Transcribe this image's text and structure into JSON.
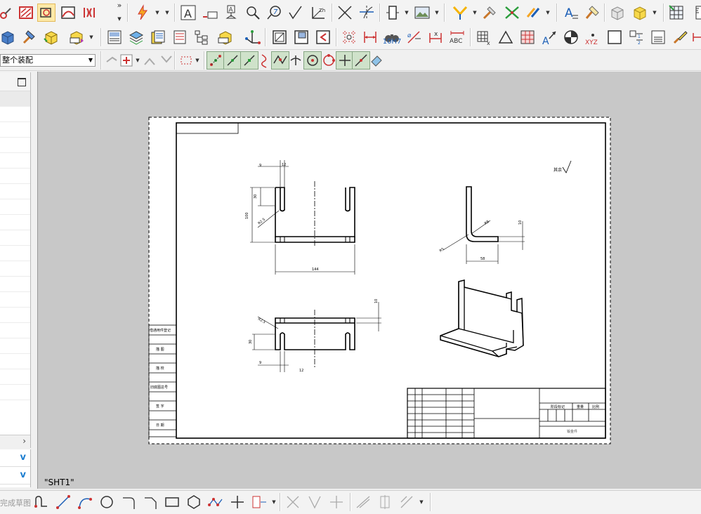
{
  "toolbar": {
    "overflow_label": "»",
    "assembly_filter": "整个装配",
    "text_icon_label": "A",
    "fit_label": "10H7",
    "abc_label": "ABC",
    "xyz_label": "XYZ"
  },
  "sidebar": {
    "rows": 20,
    "scroll_arrow": "›",
    "chevron_1": "v",
    "chevron_2": "v"
  },
  "drawing": {
    "sheet_name": "\"SHT1\"",
    "front_view": {
      "dim_top_left": "9",
      "dim_top_right": "12",
      "dim_slot": "30",
      "dim_height": "100",
      "dim_radius": "R2.5",
      "dim_width": "144"
    },
    "side_view": {
      "dim_radius_big": "R5",
      "dim_radius_small": "R8",
      "dim_thickness": "10",
      "dim_base": "58"
    },
    "top_view": {
      "dim_radius": "R2.5",
      "dim_slot": "30",
      "dim_thickness": "10",
      "dim_bottom_left": "9",
      "dim_bottom_right": "12"
    },
    "roughness_note": "其余",
    "side_table": [
      "借通用件登记",
      "描 图",
      "描 校",
      "旧底图总号",
      "签 字",
      "日 期"
    ],
    "title_block": {
      "center_text": "钣金件",
      "labels": [
        "阶段标记",
        "重量",
        "比例"
      ]
    }
  },
  "bottom": {
    "sketch_label": "完成草图"
  }
}
